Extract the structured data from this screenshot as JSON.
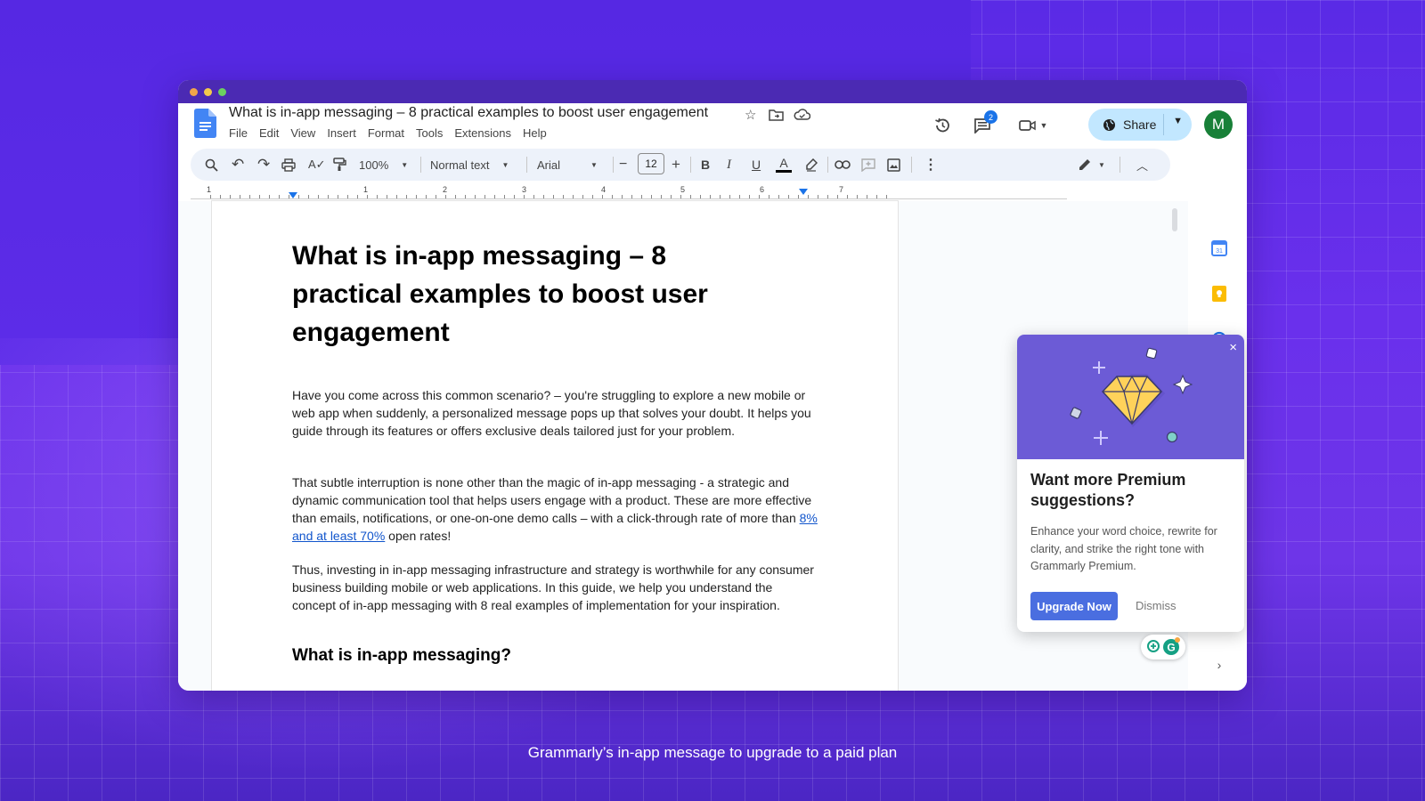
{
  "doc": {
    "title": "What is in-app messaging – 8 practical examples to boost user engagement",
    "menu": [
      "File",
      "Edit",
      "View",
      "Insert",
      "Format",
      "Tools",
      "Extensions",
      "Help"
    ]
  },
  "header": {
    "comments_badge": "2",
    "share_label": "Share",
    "avatar_initial": "M"
  },
  "toolbar": {
    "zoom": "100%",
    "style": "Normal text",
    "font": "Arial",
    "font_size": "12"
  },
  "ruler": [
    "1",
    "1",
    "2",
    "3",
    "4",
    "5",
    "6",
    "7"
  ],
  "content": {
    "h1": "What is in-app messaging – 8 practical examples to boost user engagement",
    "p1": "Have you come across this common scenario? – you're struggling to explore a new mobile or web app when suddenly, a personalized message pops up that solves your doubt. It helps you guide through its features or offers exclusive deals tailored just for your problem.",
    "p2_before": "That subtle interruption is none other than the magic of in-app messaging - a strategic and dynamic communication tool that helps users engage with a product. These are more effective than emails, notifications, or one-on-one demo calls – with a click-through rate of more than ",
    "p2_link": "8% and at least 70%",
    "p2_after": " open rates!",
    "p3": "Thus, investing in in-app messaging infrastructure and strategy is worthwhile for any consumer business building mobile or web applications. In this guide, we help you understand the concept of in-app messaging with 8 real examples of implementation for your inspiration.",
    "h2": "What is in-app messaging?"
  },
  "grammarly": {
    "title": "Want more Premium suggestions?",
    "body": "Enhance your word choice, rewrite for clarity, and strike the right tone with Grammarly Premium.",
    "upgrade": "Upgrade Now",
    "dismiss": "Dismiss",
    "close": "×"
  },
  "caption": "Grammarly’s in-app message to upgrade to a paid plan",
  "colors": {
    "background": "#5a2ae6",
    "share_button": "#c2e7ff",
    "avatar": "#188038",
    "grammarly_hero": "#6c5bd6",
    "grammarly_button": "#4a6ee0",
    "link": "#1155cc"
  }
}
